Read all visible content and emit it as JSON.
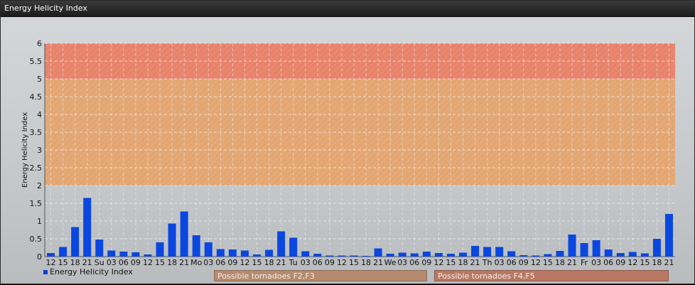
{
  "window": {
    "title": "Energy Helicity Index"
  },
  "colors": {
    "bar": "#0a47e0",
    "zone_high": "#e8826a",
    "zone_mid": "#e3a672",
    "grid": "#eeeeee"
  },
  "legend": {
    "series_label": "Energy Helicity Index",
    "zone_a_label": "Possible tornadoes F2,F3",
    "zone_b_label": "Possible tornadoes F4,F5"
  },
  "chart_data": {
    "type": "bar",
    "ylabel": "Energy Helicity Index",
    "xlabel": "",
    "ylim": [
      0,
      6
    ],
    "yticks": [
      "0",
      "0.5",
      "1",
      "1.5",
      "2",
      "2.5",
      "3",
      "3.5",
      "4",
      "4.5",
      "5",
      "5.5",
      "6"
    ],
    "grid": true,
    "bands": [
      {
        "from": 2,
        "to": 5,
        "color": "#e3a672"
      },
      {
        "from": 5,
        "to": 6,
        "color": "#e8826a"
      }
    ],
    "categories": [
      "12",
      "15",
      "18",
      "21",
      "Su",
      "03",
      "06",
      "09",
      "12",
      "15",
      "18",
      "21",
      "Mo",
      "03",
      "06",
      "09",
      "12",
      "15",
      "18",
      "21",
      "Tu",
      "03",
      "06",
      "09",
      "12",
      "15",
      "18",
      "21",
      "We",
      "03",
      "06",
      "09",
      "12",
      "15",
      "18",
      "21",
      "Th",
      "03",
      "06",
      "09",
      "12",
      "15",
      "18",
      "21",
      "Fr",
      "03",
      "06",
      "09",
      "12",
      "15",
      "18",
      "21"
    ],
    "series": [
      {
        "name": "Energy Helicity Index",
        "values": [
          0.1,
          0.27,
          0.83,
          1.65,
          0.48,
          0.17,
          0.14,
          0.12,
          0.06,
          0.4,
          0.93,
          1.27,
          0.6,
          0.4,
          0.21,
          0.2,
          0.17,
          0.06,
          0.19,
          0.71,
          0.53,
          0.15,
          0.08,
          0.03,
          0.03,
          0.03,
          0.02,
          0.23,
          0.08,
          0.11,
          0.09,
          0.14,
          0.1,
          0.08,
          0.11,
          0.3,
          0.27,
          0.27,
          0.15,
          0.04,
          0.03,
          0.07,
          0.16,
          0.62,
          0.38,
          0.46,
          0.2,
          0.1,
          0.13,
          0.09,
          0.5,
          1.2
        ]
      }
    ]
  }
}
